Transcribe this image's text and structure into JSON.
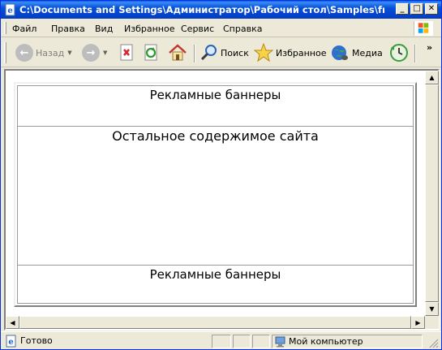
{
  "window": {
    "title": "C:\\Documents and Settings\\Администратор\\Рабочий стол\\Samples\\frame.ht...",
    "minimize": "_",
    "maximize": "□",
    "close": "✕"
  },
  "menu": {
    "items": [
      "Файл",
      "Правка",
      "Вид",
      "Избранное",
      "Сервис",
      "Справка"
    ]
  },
  "toolbar": {
    "back_label": "Назад",
    "search_label": "Поиск",
    "favorites_label": "Избранное",
    "media_label": "Медиа",
    "more": "»"
  },
  "page": {
    "top_banner": "Рекламные баннеры",
    "main_content": "Остальное содержимое сайта",
    "bottom_banner": "Рекламные баннеры"
  },
  "status": {
    "text": "Готово",
    "zone": "Мой компьютер"
  },
  "colors": {
    "titlebar": "#0450d7",
    "chrome": "#ece9d8"
  }
}
